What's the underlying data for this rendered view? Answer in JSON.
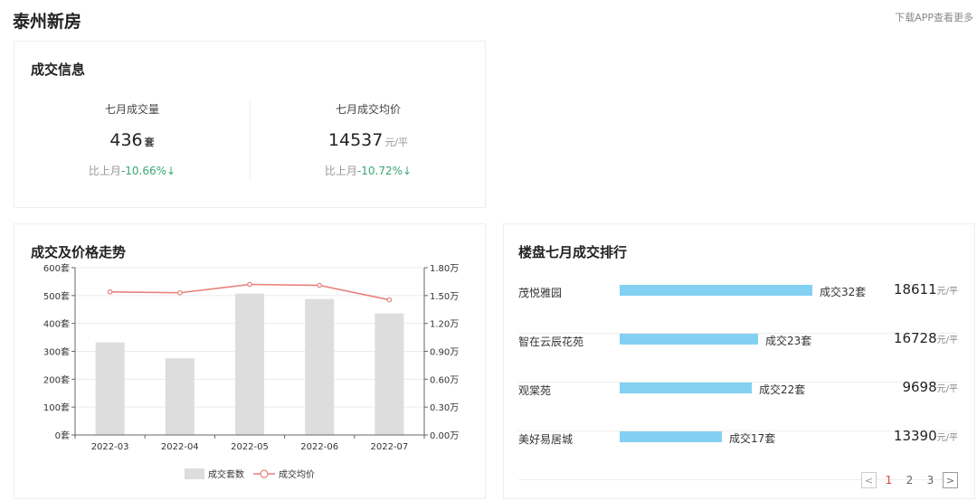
{
  "header": {
    "title": "泰州新房",
    "app_link": "下载APP查看更多"
  },
  "deal_info": {
    "title": "成交信息",
    "volume": {
      "label": "七月成交量",
      "value": "436",
      "unit": "套",
      "compare_prefix": "比上月",
      "change": "-10.66%↓"
    },
    "price": {
      "label": "七月成交均价",
      "value": "14537",
      "unit": "元/平",
      "compare_prefix": "比上月",
      "change": "-10.72%↓"
    }
  },
  "trend": {
    "title": "成交及价格走势",
    "legend": {
      "bar_label": "成交套数",
      "line_label": "成交均价"
    }
  },
  "chart_data": {
    "type": "bar",
    "categories": [
      "2022-03",
      "2022-04",
      "2022-05",
      "2022-06",
      "2022-07"
    ],
    "series": [
      {
        "name": "成交套数",
        "type": "bar",
        "axis": "left",
        "values": [
          332,
          275,
          507,
          488,
          436
        ],
        "color": "#dddddd"
      },
      {
        "name": "成交均价",
        "type": "line",
        "axis": "right",
        "values": [
          15400,
          15300,
          16200,
          16100,
          14537
        ],
        "color": "#e8807c"
      }
    ],
    "y_left": {
      "min": 0,
      "max": 600,
      "ticks": [
        0,
        100,
        200,
        300,
        400,
        500,
        600
      ],
      "tick_labels": [
        "0套",
        "100套",
        "200套",
        "300套",
        "400套",
        "500套",
        "600套"
      ]
    },
    "y_right": {
      "min": 0,
      "max": 18000,
      "ticks": [
        0,
        3000,
        6000,
        9000,
        12000,
        15000,
        18000
      ],
      "tick_labels": [
        "0.00万",
        "0.30万",
        "0.60万",
        "0.90万",
        "1.20万",
        "1.50万",
        "1.80万"
      ]
    },
    "grid": true,
    "legend_position": "bottom-center"
  },
  "ranking": {
    "title": "楼盘七月成交排行",
    "max_count": 32,
    "items": [
      {
        "name": "茂悦雅园",
        "count": 32,
        "count_label": "成交32套",
        "price": "18611",
        "unit": "元/平"
      },
      {
        "name": "智在云辰花苑",
        "count": 23,
        "count_label": "成交23套",
        "price": "16728",
        "unit": "元/平"
      },
      {
        "name": "观棠苑",
        "count": 22,
        "count_label": "成交22套",
        "price": "9698",
        "unit": "元/平"
      },
      {
        "name": "美好易居城",
        "count": 17,
        "count_label": "成交17套",
        "price": "13390",
        "unit": "元/平"
      }
    ],
    "pager": {
      "prev": "<",
      "next": ">",
      "pages": [
        "1",
        "2",
        "3"
      ],
      "current": "1"
    }
  },
  "colors": {
    "down": "#3aa676",
    "bar": "#dddddd",
    "line": "#e8807c",
    "rank_bar": "#83d0f3",
    "active_page": "#e0413f"
  }
}
